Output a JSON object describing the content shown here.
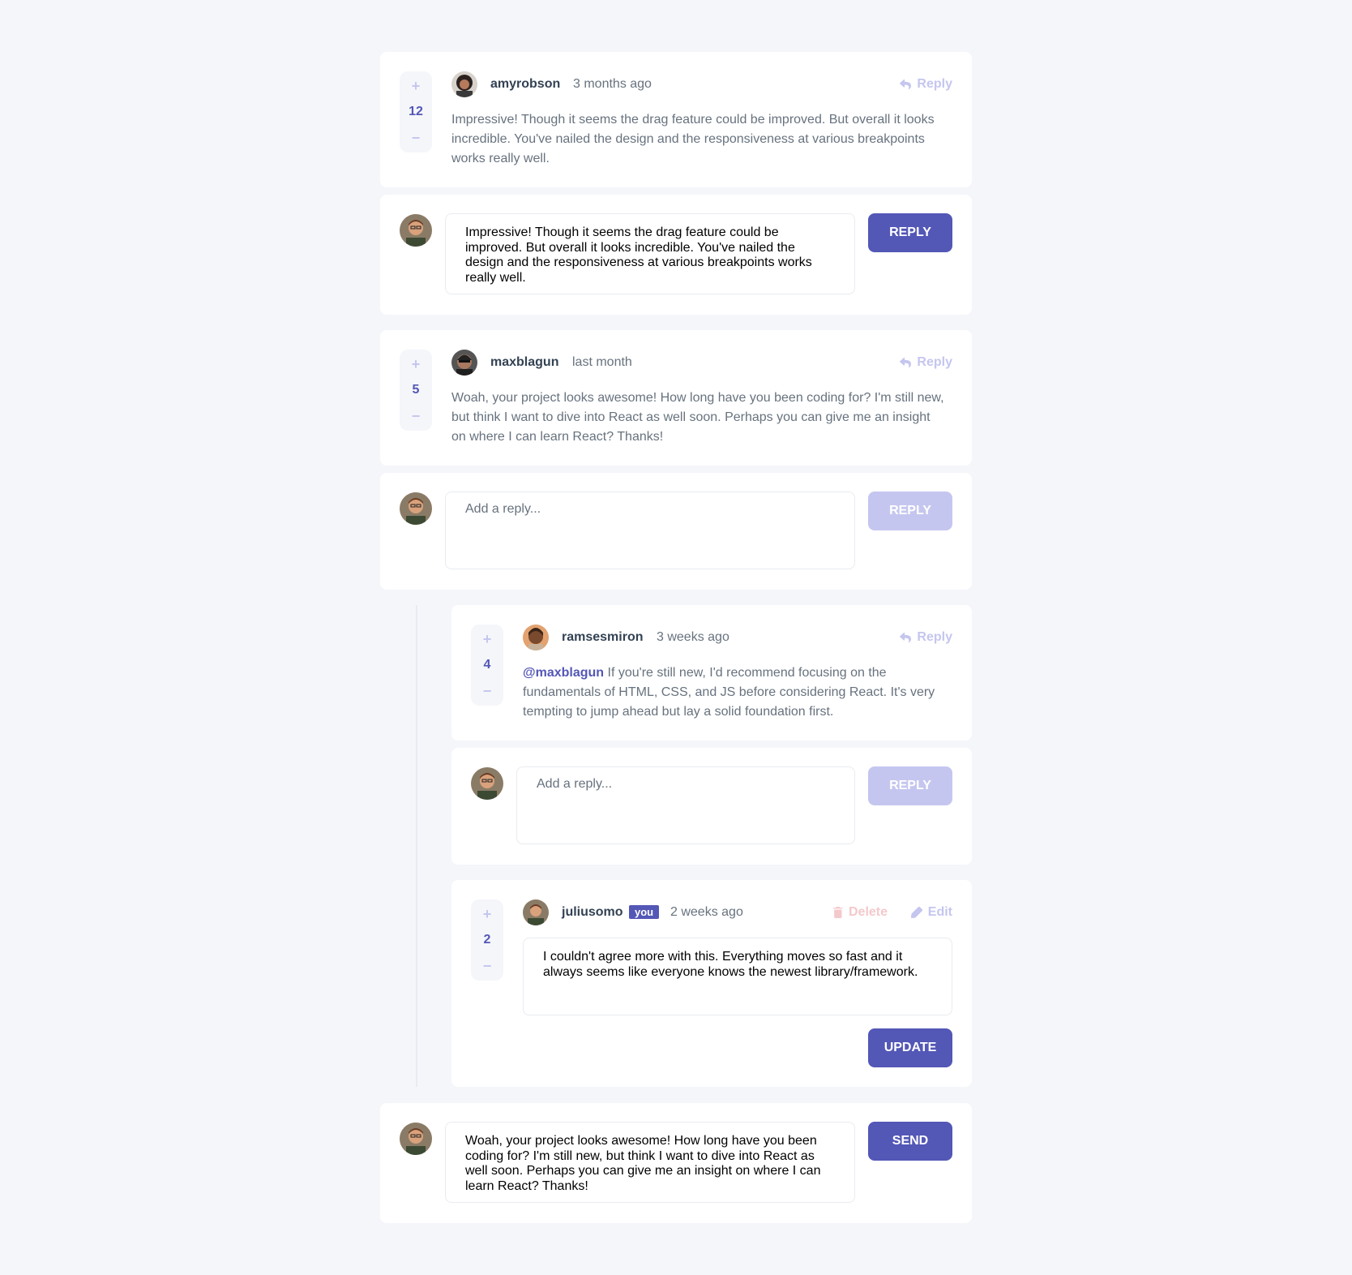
{
  "colors": {
    "accent": "#5357b6",
    "accent_light": "#c5c6ef",
    "danger_light": "#f4c9cc",
    "background": "#f5f6fa",
    "text_dark": "#334253",
    "text_body": "#67727e"
  },
  "comments": [
    {
      "score": "12",
      "username": "amyrobson",
      "time": "3 months ago",
      "reply_label": "Reply",
      "content": "Impressive! Though it seems the drag feature could be improved. But overall it looks incredible. You've nailed the design and the responsiveness at various breakpoints works really well."
    },
    {
      "score": "5",
      "username": "maxblagun",
      "time": "last month",
      "reply_label": "Reply",
      "content": "Woah, your project looks awesome! How long have you been coding for? I'm still new, but think I want to dive into React as well soon. Perhaps you can give me an insight on where I can learn React? Thanks!"
    }
  ],
  "replies": [
    {
      "score": "4",
      "username": "ramsesmiron",
      "time": "3 weeks ago",
      "reply_label": "Reply",
      "mention": "@maxblagun",
      "content": "If you're still new, I'd recommend focusing on the fundamentals of HTML, CSS, and JS before considering React. It's very tempting to jump ahead but lay a solid foundation first."
    },
    {
      "score": "2",
      "username": "juliusomo",
      "you_badge": "you",
      "time": "2 weeks ago",
      "delete_label": "Delete",
      "edit_label": "Edit",
      "edit_value": "I couldn't agree more with this. Everything moves so fast and it always seems like everyone knows the newest library/framework.",
      "update_label": "UPDATE"
    }
  ],
  "reply_forms": [
    {
      "value": "Impressive! Though it seems the drag feature could be improved. But overall it looks incredible. You've nailed the design and the responsiveness at various breakpoints works really well.",
      "button": "REPLY"
    },
    {
      "placeholder": "Add a reply...",
      "button": "REPLY"
    },
    {
      "placeholder": "Add a reply...",
      "button": "REPLY"
    }
  ],
  "new_comment": {
    "value": "Woah, your project looks awesome! How long have you been coding for? I'm still new, but think I want to dive into React as well soon. Perhaps you can give me an insight on where I can learn React? Thanks!",
    "button": "SEND"
  },
  "icons": {
    "plus": "+",
    "minus": "−",
    "reply": "reply-arrow",
    "delete": "trash",
    "edit": "pencil"
  }
}
